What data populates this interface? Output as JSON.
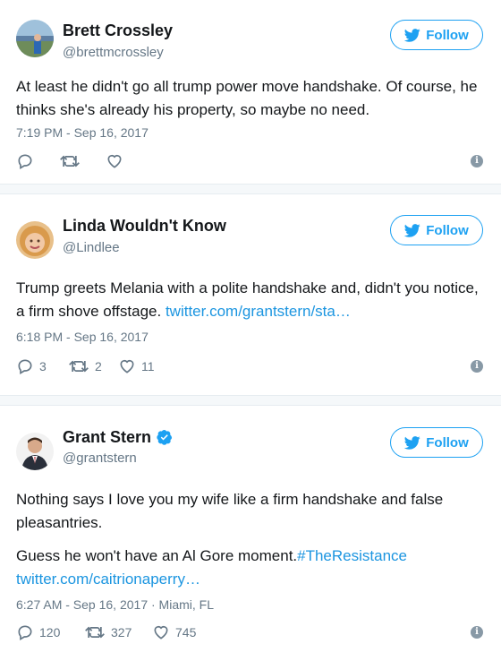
{
  "tweets": [
    {
      "name": "Brett Crossley",
      "handle": "@brettmcrossley",
      "verified": false,
      "follow_label": "Follow",
      "text": "At least he didn't go all trump power move handshake. Of course, he thinks she's already his property, so maybe no need.",
      "timestamp": "7:19 PM - Sep 16, 2017",
      "replies": "",
      "retweets": "",
      "likes": ""
    },
    {
      "name": "Linda Wouldn't Know",
      "handle": "@Lindlee",
      "verified": false,
      "follow_label": "Follow",
      "text": "Trump greets Melania with a polite handshake and, didn't you notice, a firm shove offstage.",
      "link": "twitter.com/grantstern/sta…",
      "timestamp": "6:18 PM - Sep 16, 2017",
      "replies": "3",
      "retweets": "2",
      "likes": "11"
    },
    {
      "name": "Grant Stern",
      "handle": "@grantstern",
      "verified": true,
      "follow_label": "Follow",
      "text_line1": "Nothing says I love you my wife like a firm handshake and false pleasantries.",
      "text_line2": "Guess he won't have an Al Gore moment.",
      "hashtag": "#TheResistance",
      "link": "twitter.com/caitrionaperry…",
      "timestamp": "6:27 AM - Sep 16, 2017",
      "location": " · Miami, FL",
      "replies": "120",
      "retweets": "327",
      "likes": "745"
    }
  ],
  "colors": {
    "brand_blue": "#1da1f2",
    "link_blue": "#1b95e0",
    "muted": "#657786",
    "separator_bg": "#f5f8fa"
  },
  "icons": [
    "twitter-bird-icon",
    "reply-icon",
    "retweet-icon",
    "heart-icon",
    "info-icon",
    "verified-badge-icon"
  ]
}
